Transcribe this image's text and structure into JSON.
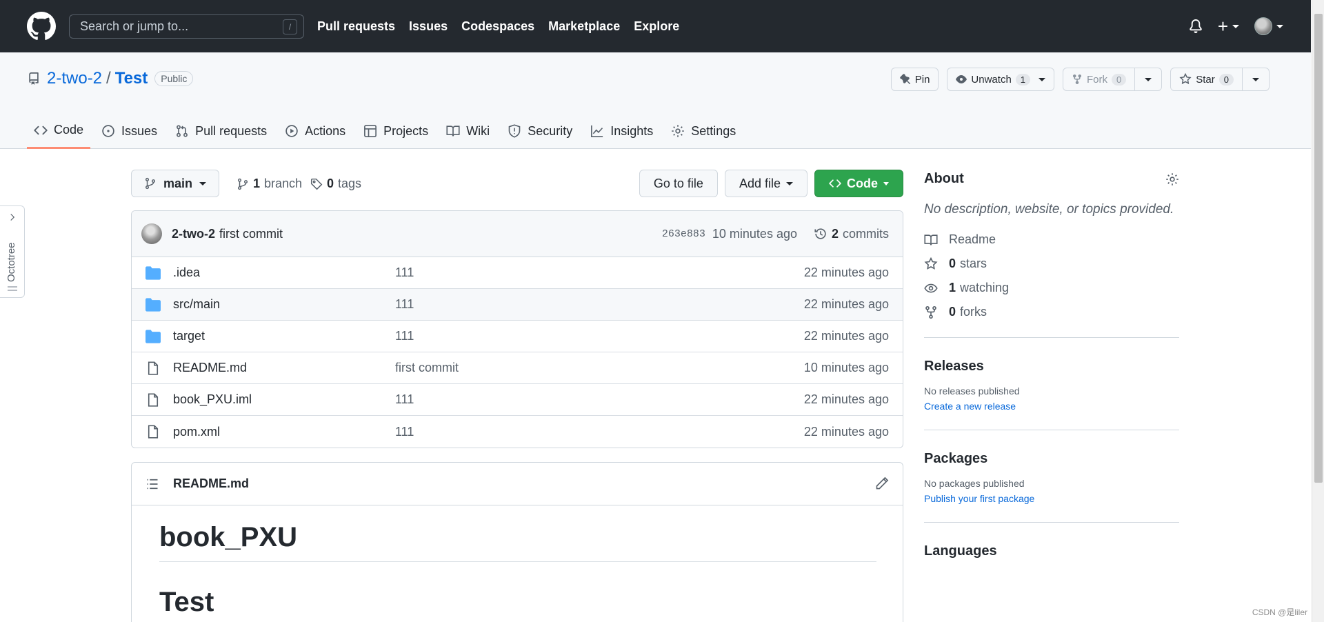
{
  "header": {
    "search_placeholder": "Search or jump to...",
    "search_shortcut": "/",
    "nav": [
      "Pull requests",
      "Issues",
      "Codespaces",
      "Marketplace",
      "Explore"
    ],
    "plus_label": "+"
  },
  "repo": {
    "owner": "2-two-2",
    "separator": "/",
    "name": "Test",
    "visibility": "Public",
    "pin_label": "Pin",
    "unwatch_label": "Unwatch",
    "unwatch_count": "1",
    "fork_label": "Fork",
    "fork_count": "0",
    "star_label": "Star",
    "star_count": "0"
  },
  "tabs": [
    {
      "label": "Code",
      "icon": "code-icon",
      "active": true
    },
    {
      "label": "Issues",
      "icon": "issue-icon"
    },
    {
      "label": "Pull requests",
      "icon": "pull-request-icon"
    },
    {
      "label": "Actions",
      "icon": "play-icon"
    },
    {
      "label": "Projects",
      "icon": "table-icon"
    },
    {
      "label": "Wiki",
      "icon": "book-icon"
    },
    {
      "label": "Security",
      "icon": "shield-icon"
    },
    {
      "label": "Insights",
      "icon": "graph-icon"
    },
    {
      "label": "Settings",
      "icon": "gear-icon"
    }
  ],
  "octotree": {
    "label": "Octotree"
  },
  "branchbar": {
    "branch": "main",
    "branch_count": "1",
    "branch_word": "branch",
    "tag_count": "0",
    "tag_word": "tags",
    "go_to_file": "Go to file",
    "add_file": "Add file",
    "code": "Code"
  },
  "commit": {
    "author": "2-two-2",
    "message": "first commit",
    "sha": "263e883",
    "time": "10 minutes ago",
    "count": "2",
    "count_word": "commits"
  },
  "files": [
    {
      "type": "dir",
      "name": ".idea",
      "message": "111",
      "age": "22 minutes ago"
    },
    {
      "type": "dir",
      "name": "src/main",
      "message": "111",
      "age": "22 minutes ago"
    },
    {
      "type": "dir",
      "name": "target",
      "message": "111",
      "age": "22 minutes ago"
    },
    {
      "type": "file",
      "name": "README.md",
      "message": "first commit",
      "age": "10 minutes ago"
    },
    {
      "type": "file",
      "name": "book_PXU.iml",
      "message": "111",
      "age": "22 minutes ago"
    },
    {
      "type": "file",
      "name": "pom.xml",
      "message": "111",
      "age": "22 minutes ago"
    }
  ],
  "readme": {
    "filename": "README.md",
    "h1": "book_PXU",
    "h2": "Test"
  },
  "about": {
    "title": "About",
    "description": "No description, website, or topics provided.",
    "readme": "Readme",
    "stars_count": "0",
    "stars_word": "stars",
    "watching_count": "1",
    "watching_word": "watching",
    "forks_count": "0",
    "forks_word": "forks"
  },
  "releases": {
    "title": "Releases",
    "empty": "No releases published",
    "link": "Create a new release"
  },
  "packages": {
    "title": "Packages",
    "empty": "No packages published",
    "link": "Publish your first package"
  },
  "languages": {
    "title": "Languages"
  },
  "watermark": "CSDN @是liler",
  "colors": {
    "header_bg": "#24292f",
    "accent": "#0969da",
    "green": "#2da44e",
    "tab_underline": "#fd8c73",
    "folder": "#54aeff"
  }
}
